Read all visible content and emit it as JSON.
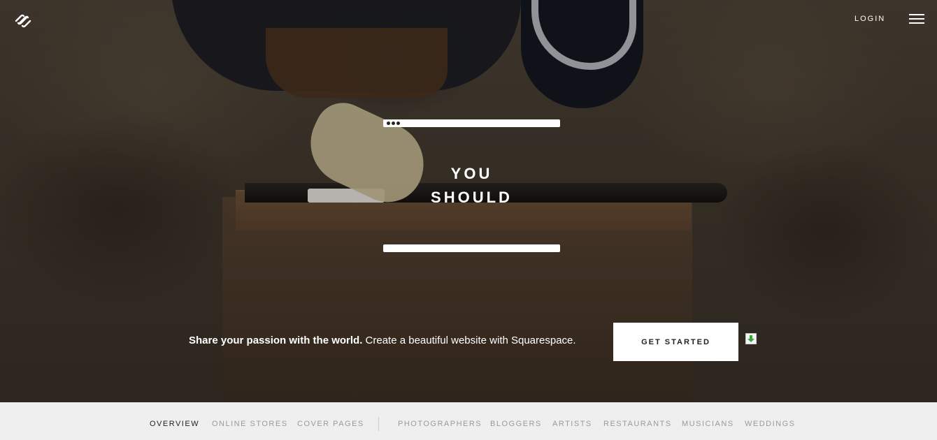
{
  "header": {
    "login_label": "LOGIN"
  },
  "hero": {
    "headline_line1": "YOU",
    "headline_line2": "SHOULD",
    "tagline_bold": "Share your passion with the world.",
    "tagline_rest": "Create a beautiful website with Squarespace.",
    "cta_label": "GET STARTED"
  },
  "category_nav": {
    "primary": [
      "OVERVIEW",
      "ONLINE STORES",
      "COVER PAGES"
    ],
    "secondary": [
      "PHOTOGRAPHERS",
      "BLOGGERS",
      "ARTISTS",
      "RESTAURANTS",
      "MUSICIANS",
      "WEDDINGS"
    ],
    "active": "OVERVIEW"
  },
  "icons": {
    "logo": "squarespace-logo-icon",
    "menu": "hamburger-menu-icon",
    "download": "download-arrow-icon"
  },
  "colors": {
    "nav_bg": "#efefef",
    "nav_active": "#222222",
    "nav_inactive": "#9a9a9a",
    "cta_bg": "#ffffff",
    "download_green": "#3aa63a"
  }
}
